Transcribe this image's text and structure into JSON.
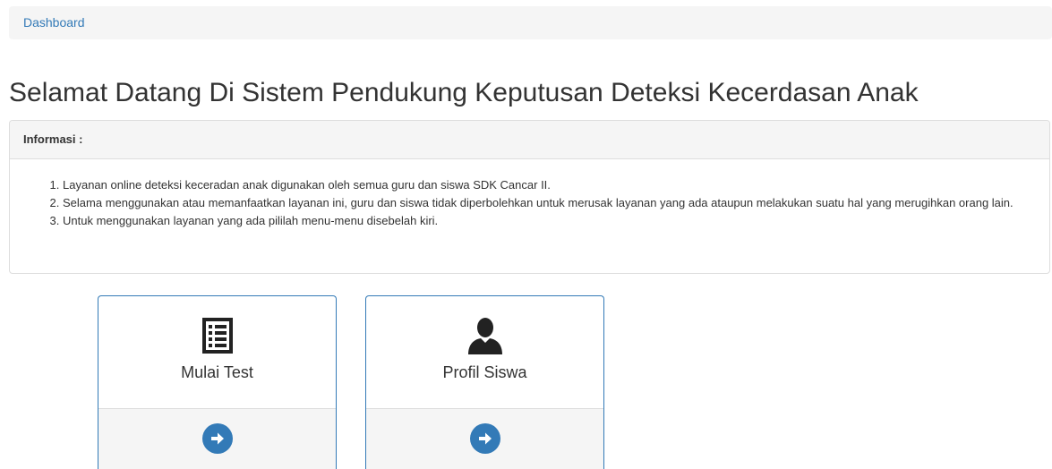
{
  "breadcrumb": {
    "current": "Dashboard"
  },
  "page": {
    "title": "Selamat Datang Di Sistem Pendukung Keputusan Deteksi Kecerdasan Anak"
  },
  "info_panel": {
    "heading": "Informasi :",
    "items": [
      "Layanan online deteksi keceradan anak digunakan oleh semua guru dan siswa SDK Cancar II.",
      "Selama menggunakan atau memanfaatkan layanan ini, guru dan siswa tidak diperbolehkan untuk merusak layanan yang ada ataupun melakukan suatu hal yang merugihkan orang lain.",
      "Untuk menggunakan layanan yang ada pililah menu-menu disebelah kiri."
    ]
  },
  "tiles": [
    {
      "label": "Mulai Test",
      "icon": "list-icon"
    },
    {
      "label": "Profil Siswa",
      "icon": "user-icon"
    }
  ],
  "colors": {
    "accent": "#337ab7",
    "panel_bg": "#f5f5f5",
    "border": "#dddddd",
    "text": "#333333"
  }
}
